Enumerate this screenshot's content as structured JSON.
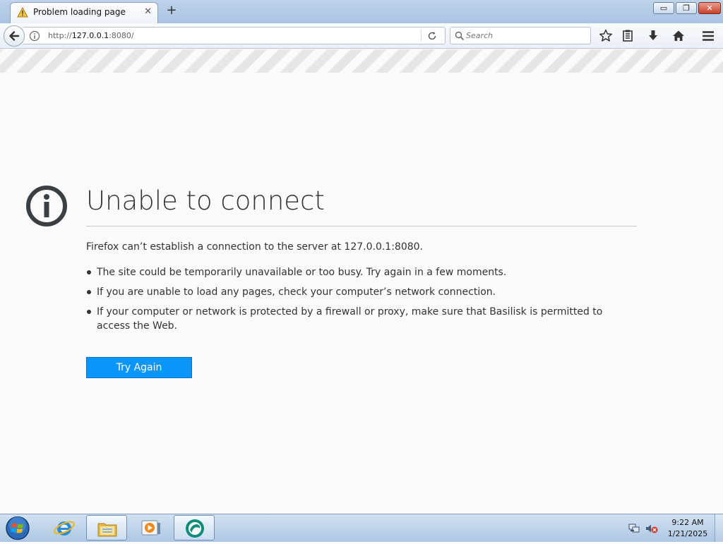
{
  "browser": {
    "tab": {
      "title": "Problem loading page",
      "icon": "warning-icon",
      "close_glyph": "✕"
    },
    "new_tab_glyph": "+",
    "window_controls": {
      "minimize_glyph": "▭",
      "maximize_glyph": "❐",
      "close_glyph": "✕"
    },
    "url": {
      "scheme": "http://",
      "host": "127.0.0.1",
      "rest": ":8080/"
    },
    "search": {
      "placeholder": "Search"
    },
    "toolbar_icons": [
      "bookmark-star-icon",
      "reading-list-icon",
      "downloads-icon",
      "home-icon",
      "menu-icon"
    ]
  },
  "error_page": {
    "title": "Unable to connect",
    "description": "Firefox can’t establish a connection to the server at 127.0.0.1:8080.",
    "bullets": [
      "The site could be temporarily unavailable or too busy. Try again in a few moments.",
      "If you are unable to load any pages, check your computer’s network connection.",
      "If your computer or network is protected by a firewall or proxy, make sure that Basilisk is permitted to access the Web."
    ],
    "button_label": "Try Again"
  },
  "taskbar": {
    "pinned": [
      "internet-explorer-icon",
      "file-explorer-icon",
      "media-player-icon",
      "basilisk-icon"
    ],
    "clock": {
      "time": "9:22 AM",
      "date": "1/21/2025"
    }
  },
  "colors": {
    "accent_button": "#0996f8",
    "title_bar": "#bfd3ea",
    "page_background": "#fafafa",
    "text": "#333333"
  }
}
